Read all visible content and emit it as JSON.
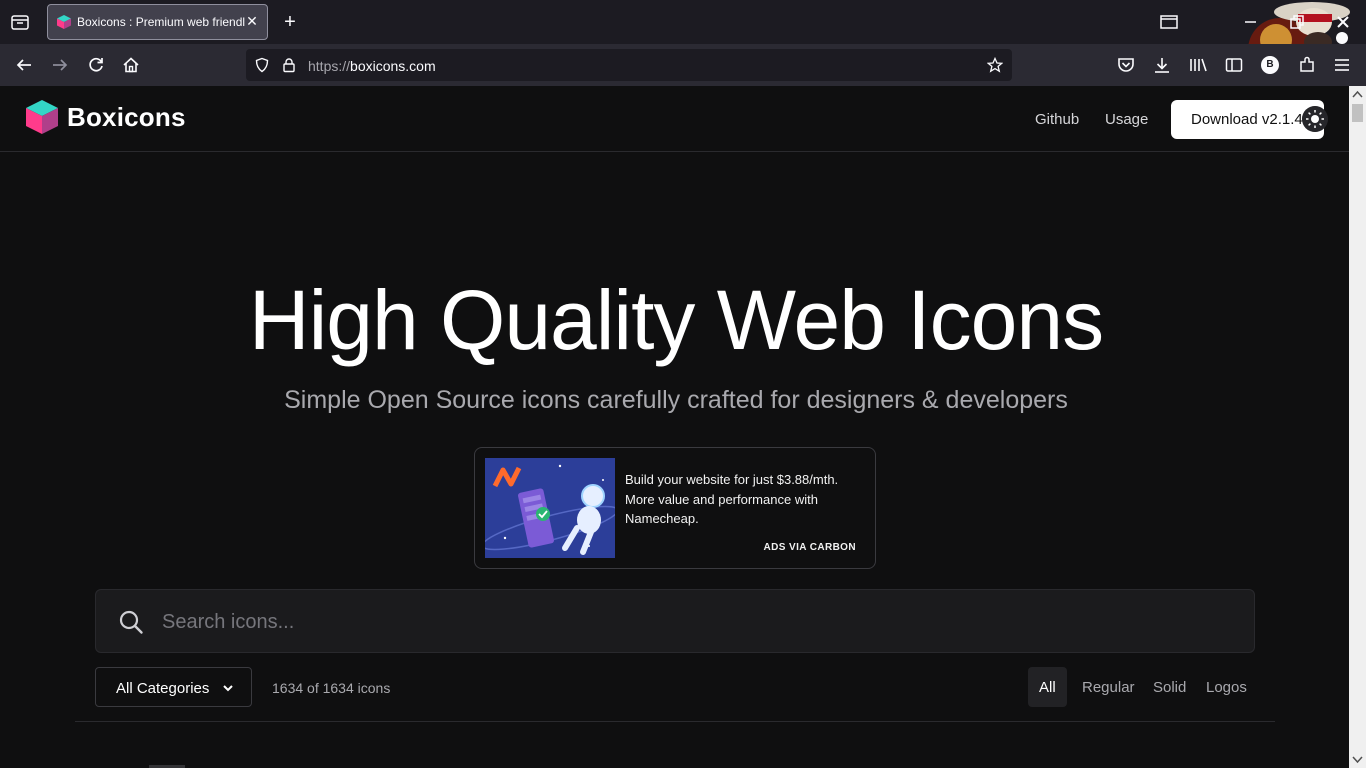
{
  "browser": {
    "tab_title": "Boxicons : Premium web friendly icons",
    "url_scheme": "https://",
    "url_host": "boxicons.com",
    "profile_initial": "B"
  },
  "header": {
    "logo_text": "Boxicons",
    "nav": [
      "Github",
      "Usage"
    ],
    "download_label": "Download v2.1.4"
  },
  "hero": {
    "title": "High Quality Web Icons",
    "subtitle": "Simple Open Source icons carefully crafted for designers & developers"
  },
  "ad": {
    "text": "Build your website for just $3.88/mth. More value and performance with Namecheap.",
    "via": "ADS VIA CARBON"
  },
  "search": {
    "placeholder": "Search icons..."
  },
  "filters": {
    "category": "All Categories",
    "count": "1634 of 1634 icons",
    "types": [
      "All",
      "Regular",
      "Solid",
      "Logos"
    ],
    "active": "All"
  },
  "colors": {
    "page_bg": "#0f0f10",
    "logo_teal": "#33d6c6",
    "logo_pink": "#ff3b8b",
    "ad_bg": "#2c3e99"
  }
}
